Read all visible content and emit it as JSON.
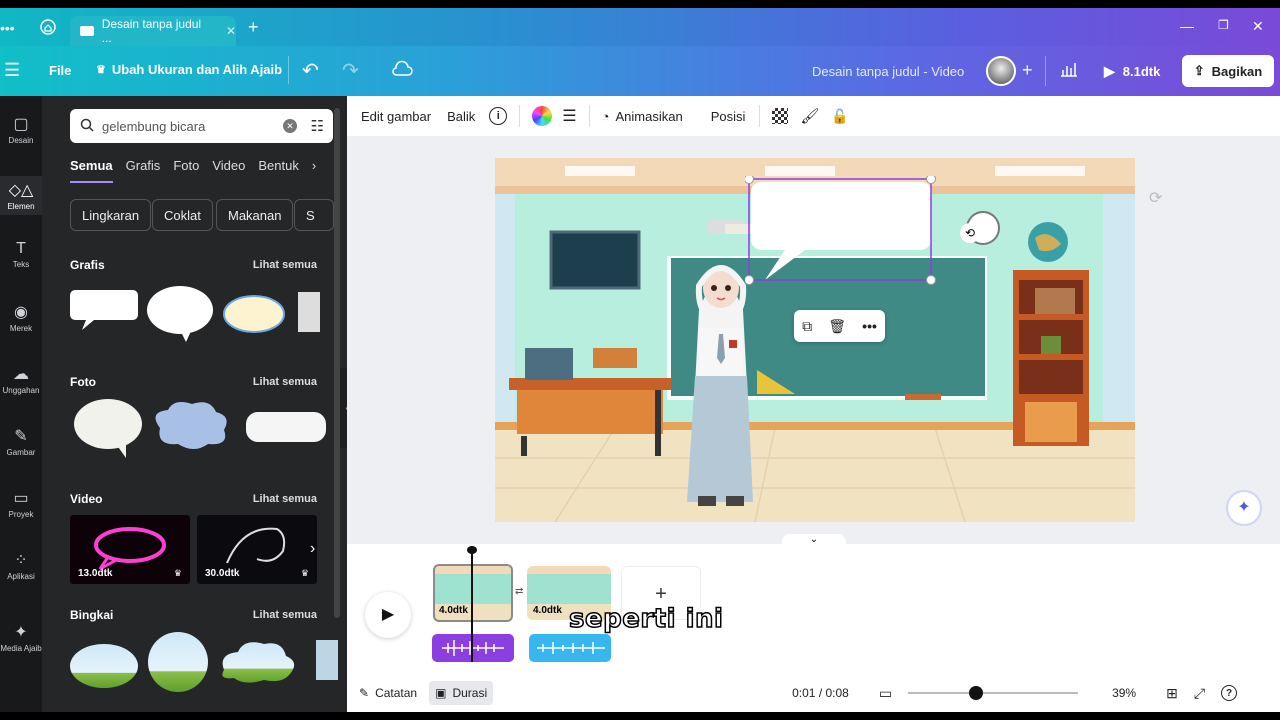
{
  "tabs": {
    "active_title": "Desain tanpa judul ..."
  },
  "topbar": {
    "file": "File",
    "resize": "Ubah Ukuran dan Alih Ajaib",
    "doc_title": "Desain tanpa judul - Video",
    "play_duration": "8.1dtk",
    "share": "Bagikan"
  },
  "rail": [
    {
      "label": "Desain",
      "icon": "layout-icon"
    },
    {
      "label": "Elemen",
      "icon": "elements-icon"
    },
    {
      "label": "Teks",
      "icon": "text-icon"
    },
    {
      "label": "Merek",
      "icon": "brand-icon"
    },
    {
      "label": "Unggahan",
      "icon": "upload-icon"
    },
    {
      "label": "Gambar",
      "icon": "draw-icon"
    },
    {
      "label": "Proyek",
      "icon": "folder-icon"
    },
    {
      "label": "Aplikasi",
      "icon": "apps-icon"
    },
    {
      "label": "Media Ajaib",
      "icon": "magic-media-icon"
    }
  ],
  "search": {
    "value": "gelembung bicara"
  },
  "filters": [
    "Semua",
    "Grafis",
    "Foto",
    "Video",
    "Bentuk"
  ],
  "chips": [
    "Lingkaran",
    "Coklat",
    "Makanan",
    "S"
  ],
  "sections": {
    "grafis": "Grafis",
    "foto": "Foto",
    "video": "Video",
    "bingkai": "Bingkai",
    "see_all": "Lihat semua"
  },
  "videos": [
    {
      "duration": "13.0dtk"
    },
    {
      "duration": "30.0dtk"
    }
  ],
  "context_toolbar": {
    "edit": "Edit gambar",
    "flip": "Balik",
    "animate": "Animasikan",
    "position": "Posisi"
  },
  "timeline": {
    "clips": [
      {
        "duration": "4.0dtk"
      },
      {
        "duration": "4.0dtk"
      }
    ],
    "caption": "seperti ini"
  },
  "bottombar": {
    "notes": "Catatan",
    "duration": "Durasi",
    "time": "0:01 / 0:08",
    "zoom": "39%",
    "zoom_level": 0.39
  },
  "colors": {
    "accent": "#7d2ae8",
    "audio1": "#8b3fe0",
    "audio2": "#38b6f0"
  }
}
